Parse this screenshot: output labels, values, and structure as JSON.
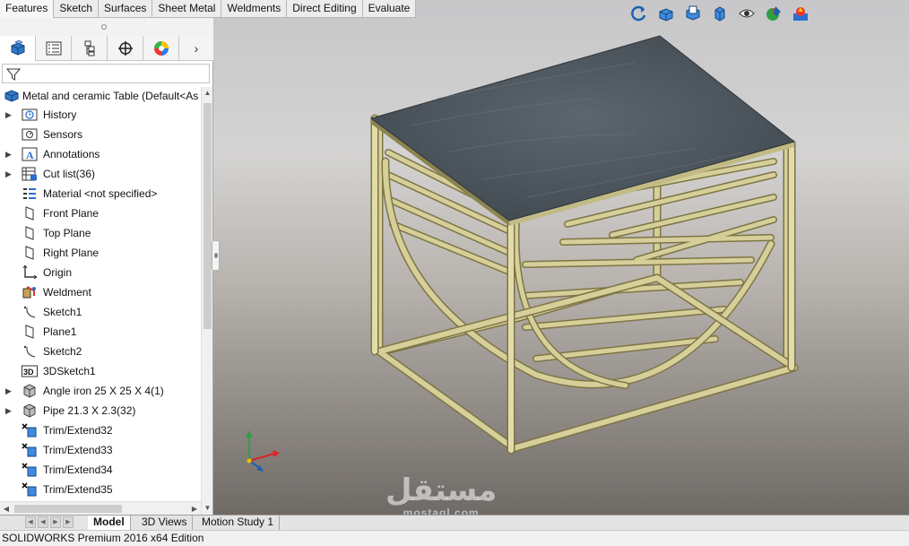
{
  "command_tabs": [
    "Features",
    "Sketch",
    "Surfaces",
    "Sheet Metal",
    "Weldments",
    "Direct Editing",
    "Evaluate"
  ],
  "feature_tree": {
    "root_label": "Metal and ceramic Table  (Default<As",
    "items": [
      {
        "label": "History",
        "icon": "history-icon",
        "expandable": true
      },
      {
        "label": "Sensors",
        "icon": "sensors-icon",
        "expandable": false
      },
      {
        "label": "Annotations",
        "icon": "annotations-icon",
        "expandable": true
      },
      {
        "label": "Cut list(36)",
        "icon": "cut-list-icon",
        "expandable": true
      },
      {
        "label": "Material <not specified>",
        "icon": "material-icon",
        "expandable": false
      },
      {
        "label": "Front Plane",
        "icon": "plane-icon",
        "expandable": false
      },
      {
        "label": "Top Plane",
        "icon": "plane-icon",
        "expandable": false
      },
      {
        "label": "Right Plane",
        "icon": "plane-icon",
        "expandable": false
      },
      {
        "label": "Origin",
        "icon": "origin-icon",
        "expandable": false
      },
      {
        "label": "Weldment",
        "icon": "weldment-icon",
        "expandable": false
      },
      {
        "label": "Sketch1",
        "icon": "sketch-icon",
        "expandable": false
      },
      {
        "label": "Plane1",
        "icon": "plane-icon",
        "expandable": false
      },
      {
        "label": "Sketch2",
        "icon": "sketch-icon",
        "expandable": false
      },
      {
        "label": "3DSketch1",
        "icon": "3dsketch-icon",
        "expandable": false
      },
      {
        "label": "Angle iron 25 X 25 X 4(1)",
        "icon": "structural-member-icon",
        "expandable": true
      },
      {
        "label": "Pipe 21.3 X 2.3(32)",
        "icon": "structural-member-icon",
        "expandable": true
      },
      {
        "label": "Trim/Extend32",
        "icon": "trim-extend-icon",
        "expandable": false
      },
      {
        "label": "Trim/Extend33",
        "icon": "trim-extend-icon",
        "expandable": false
      },
      {
        "label": "Trim/Extend34",
        "icon": "trim-extend-icon",
        "expandable": false
      },
      {
        "label": "Trim/Extend35",
        "icon": "trim-extend-icon",
        "expandable": false
      }
    ]
  },
  "bottom_tabs": [
    "Model",
    "3D Views",
    "Motion Study 1"
  ],
  "status_bar": "SOLIDWORKS Premium 2016 x64 Edition",
  "watermark": {
    "arabic": "مستقل",
    "latin": "mostaql.com"
  },
  "colors": {
    "frame": "#d6cf9a",
    "frame_dark": "#7d7544",
    "top": "#4a535b",
    "accent_blue": "#1a62b5"
  }
}
